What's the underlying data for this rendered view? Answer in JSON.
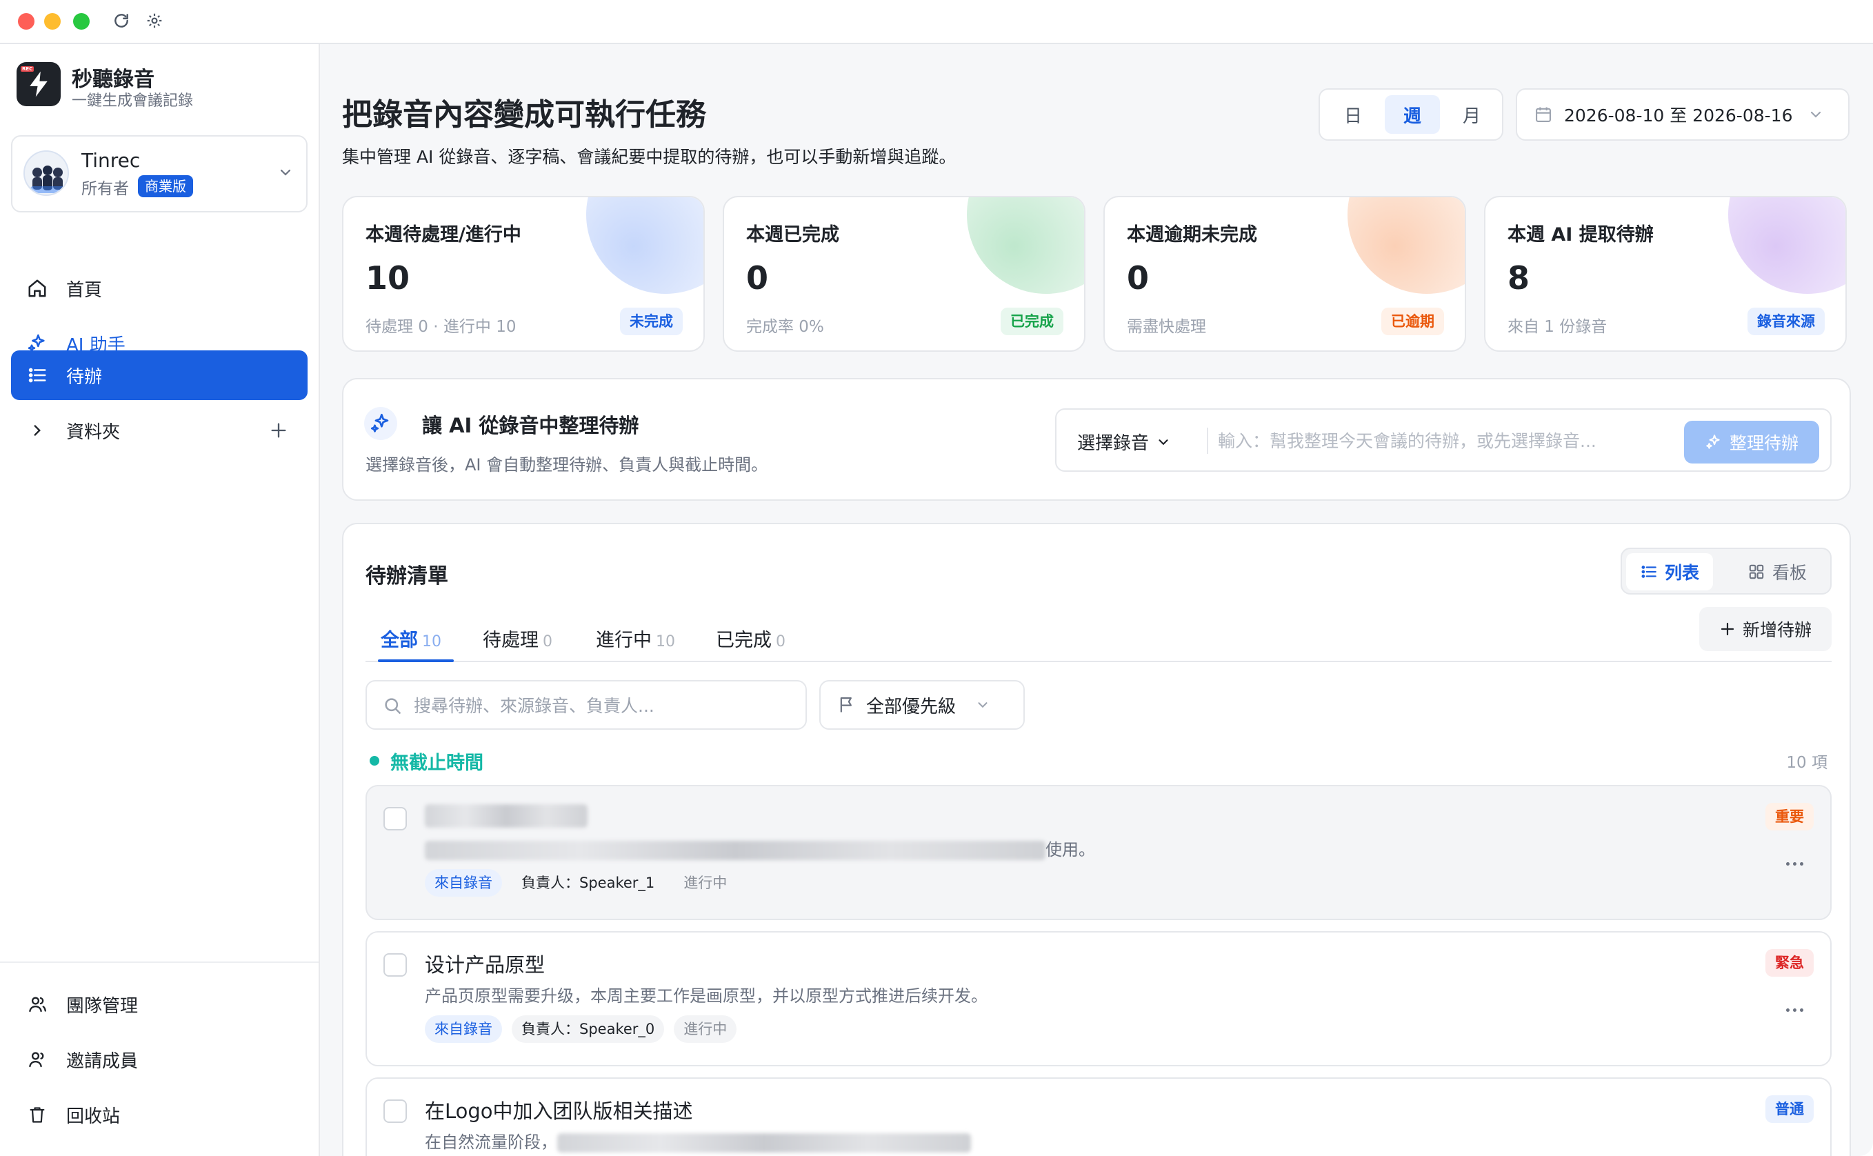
{
  "brand": {
    "name": "秒聽錄音",
    "tagline": "一鍵生成會議記錄",
    "logo_tag": "REC"
  },
  "account": {
    "name": "Tinrec",
    "role": "所有者",
    "plan": "商業版"
  },
  "nav": [
    {
      "id": "home",
      "label": "首頁",
      "icon": "home-icon"
    },
    {
      "id": "ai",
      "label": "AI 助手",
      "icon": "sparkles-icon"
    },
    {
      "id": "todo",
      "label": "待辦",
      "icon": "list-icon",
      "active": true
    },
    {
      "id": "folders",
      "label": "資料夾",
      "icon": "chevron-right-icon"
    }
  ],
  "bottom_nav": [
    {
      "label": "團隊管理",
      "icon": "team-icon"
    },
    {
      "label": "邀請成員",
      "icon": "invite-icon"
    },
    {
      "label": "回收站",
      "icon": "trash-icon"
    }
  ],
  "header": {
    "title": "把錄音內容變成可執行任務",
    "subtitle": "集中管理 AI 從錄音、逐字稿、會議紀要中提取的待辦，也可以手動新增與追蹤。",
    "period": {
      "options": [
        "日",
        "週",
        "月"
      ],
      "selected": "週"
    },
    "date_range": "2026-08-10 至 2026-08-16"
  },
  "stats": [
    {
      "title": "本週待處理/進行中",
      "value": "10",
      "foot": "待處理 0 · 進行中 10",
      "badge": "未完成",
      "accent": "#1a5fe0"
    },
    {
      "title": "本週已完成",
      "value": "0",
      "foot": "完成率 0%",
      "badge": "已完成",
      "accent": "#16a34a"
    },
    {
      "title": "本週逾期未完成",
      "value": "0",
      "foot": "需盡快處理",
      "badge": "已逾期",
      "accent": "#ea580c"
    },
    {
      "title": "本週 AI 提取待辦",
      "value": "8",
      "foot": "來自 1 份錄音",
      "badge": "錄音來源",
      "accent": "#1a5fe0"
    }
  ],
  "ai_panel": {
    "title": "讓 AI 從錄音中整理待辦",
    "subtitle": "選擇錄音後，AI 會自動整理待辦、負責人與截止時間。",
    "select_label": "選擇錄音",
    "input_placeholder": "輸入：幫我整理今天會議的待辦，或先選擇錄音...",
    "button_label": "整理待辦"
  },
  "todo_list": {
    "title": "待辦清單",
    "view": {
      "list_label": "列表",
      "board_label": "看板",
      "selected": "列表"
    },
    "add_label": "新增待辦",
    "tabs": [
      {
        "label": "全部",
        "count": "10",
        "active": true
      },
      {
        "label": "待處理",
        "count": "0"
      },
      {
        "label": "進行中",
        "count": "10"
      },
      {
        "label": "已完成",
        "count": "0"
      }
    ],
    "search_placeholder": "搜尋待辦、來源錄音、負責人...",
    "priority_filter": "全部優先級",
    "group": {
      "title": "無截止時間",
      "count": "10 項"
    },
    "items": [
      {
        "title": "",
        "description_end": "使用。",
        "source": "來自錄音",
        "assignee": "負責人：Speaker_1",
        "status": "進行中",
        "priority": "重要",
        "priority_color": "#ea580c",
        "priority_bg": "#fff1e8"
      },
      {
        "title": "设计产品原型",
        "description": "产品页原型需要升级，本周主要工作是画原型，并以原型方式推进后续开发。",
        "source": "來自錄音",
        "assignee": "負責人：Speaker_0",
        "status": "進行中",
        "priority": "緊急",
        "priority_color": "#dc2626",
        "priority_bg": "#fdeaea"
      },
      {
        "title": "在Logo中加入团队版相关描述",
        "description_start": "在自然流量阶段，",
        "priority": "普通",
        "priority_color": "#1a5fe0",
        "priority_bg": "#eaf1fe"
      }
    ]
  }
}
